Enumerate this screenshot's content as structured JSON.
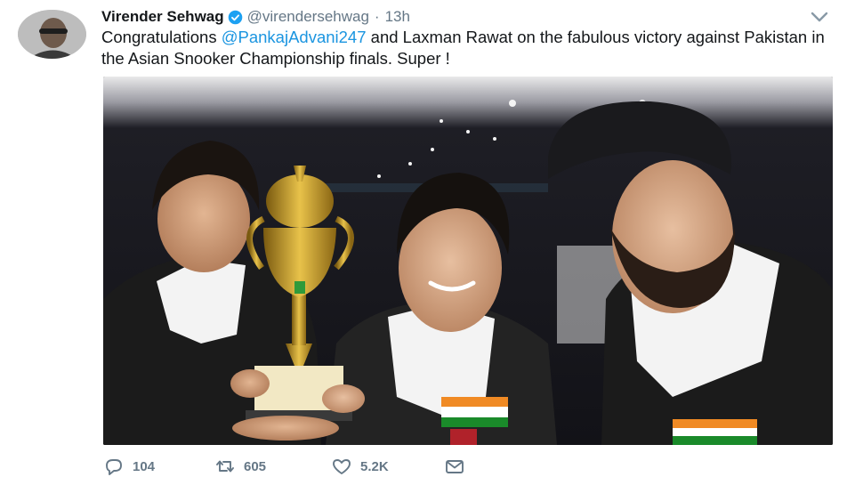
{
  "author": {
    "display_name": "Virender Sehwag",
    "handle": "@virendersehwag",
    "separator": "·",
    "time": "13h",
    "verified": true
  },
  "tweet": {
    "text_before": "Congratulations ",
    "mention": "@PankajAdvani247",
    "text_after": " and Laxman Rawat on the fabulous victory against Pakistan in the Asian Snooker Championship finals. Super !"
  },
  "media": {
    "kind": "photo",
    "description_icon": "photo-icon"
  },
  "actions": {
    "reply_count": "104",
    "retweet_count": "605",
    "like_count": "5.2K"
  },
  "colors": {
    "link": "#1b95e0",
    "secondary_text": "#657786",
    "verified_badge": "#1da1f2"
  }
}
